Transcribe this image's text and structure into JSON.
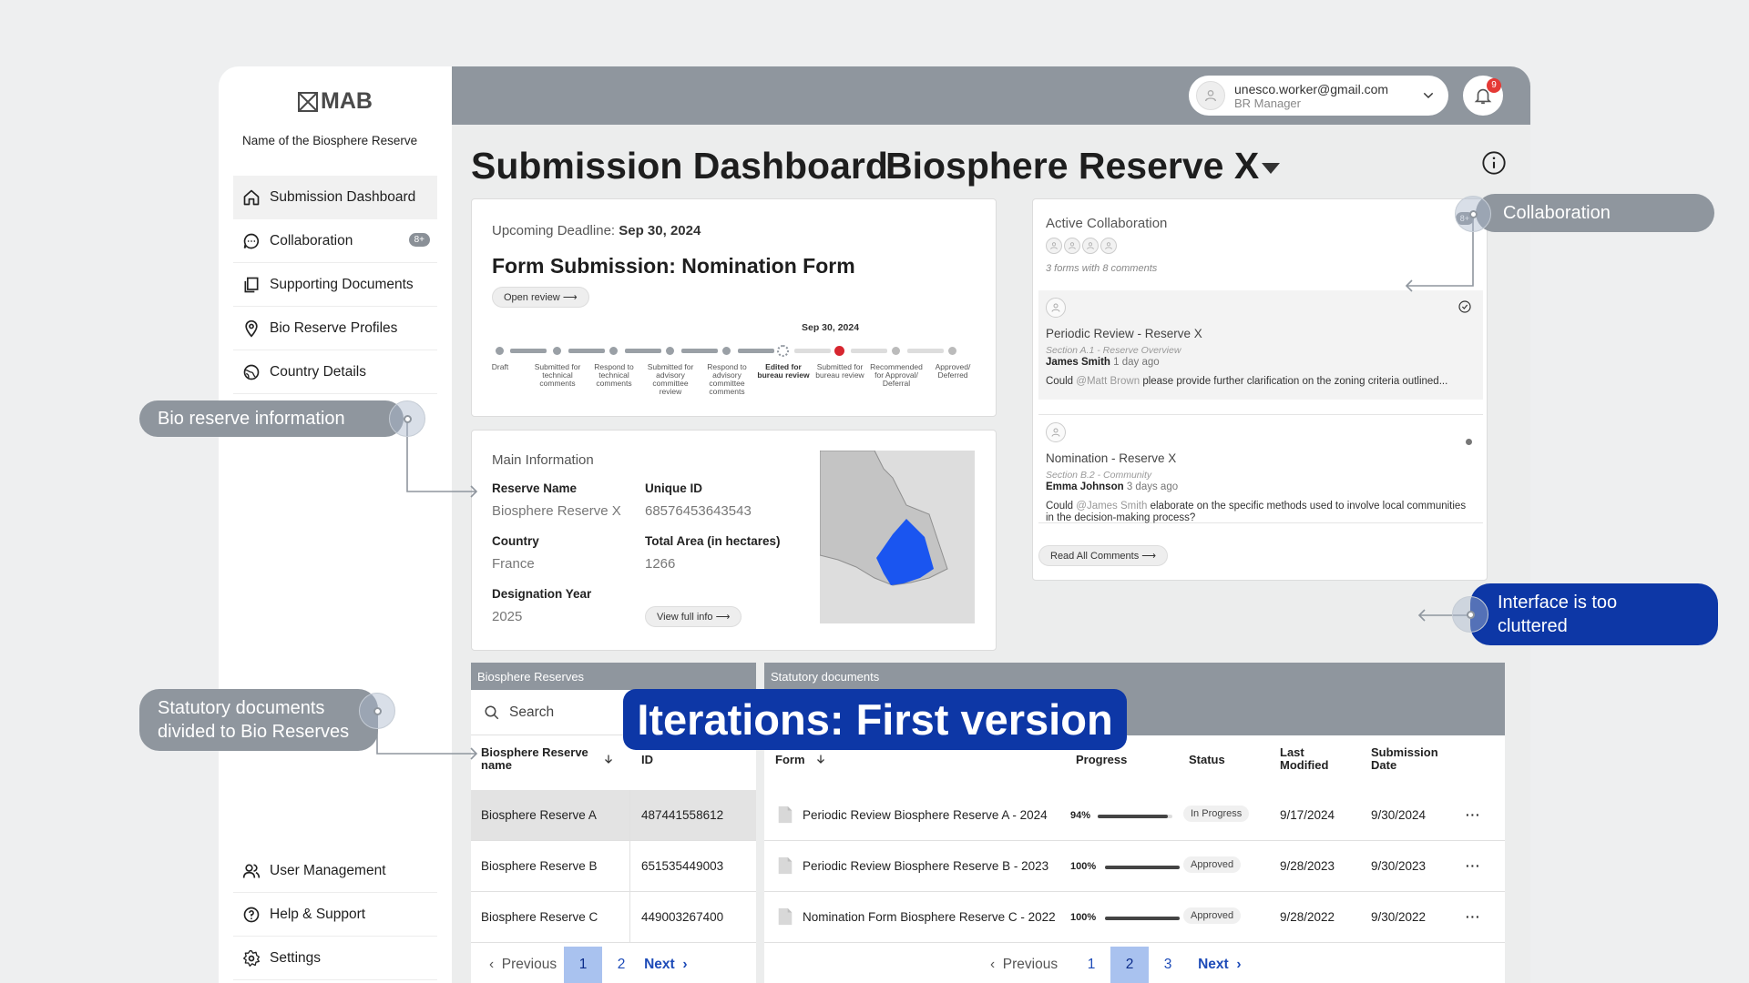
{
  "sidebar": {
    "logo": "MAB",
    "reserve_name": "Name of the Biosphere Reserve",
    "nav": [
      {
        "label": "Submission Dashboard",
        "icon": "home-icon"
      },
      {
        "label": "Collaboration",
        "icon": "chat-icon",
        "badge": "8+"
      },
      {
        "label": "Supporting Documents",
        "icon": "documents-icon"
      },
      {
        "label": "Bio Reserve Profiles",
        "icon": "location-pin-icon"
      },
      {
        "label": "Country Details",
        "icon": "globe-icon"
      }
    ],
    "bottom_nav": [
      {
        "label": "User Management",
        "icon": "users-icon"
      },
      {
        "label": "Help & Support",
        "icon": "help-icon"
      },
      {
        "label": "Settings",
        "icon": "settings-icon"
      }
    ]
  },
  "topbar": {
    "email": "unesco.worker@gmail.com",
    "role": "BR Manager",
    "notification_count": "9"
  },
  "header": {
    "title": "Submission Dashboard",
    "reserve": "Biosphere Reserve X"
  },
  "deadline": {
    "label": "Upcoming Deadline:",
    "date": "Sep 30, 2024",
    "form_title": "Form Submission: Nomination Form",
    "open_review": "Open review",
    "timeline_date": "Sep 30, 2024",
    "steps": [
      {
        "label": "Draft"
      },
      {
        "label": "Submitted for technical comments"
      },
      {
        "label": "Respond to technical comments"
      },
      {
        "label": "Submitted for advisory committee review"
      },
      {
        "label": "Respond to advisory committee comments"
      },
      {
        "label": "Edited for bureau review"
      },
      {
        "label": "Submitted for bureau review"
      },
      {
        "label": "Recommended for Approval/ Deferral"
      },
      {
        "label": "Approved/ Deferred"
      }
    ]
  },
  "main_info": {
    "heading": "Main Information",
    "reserve_name_label": "Reserve Name",
    "reserve_name": "Biosphere Reserve X",
    "unique_id_label": "Unique ID",
    "unique_id": "68576453643543",
    "country_label": "Country",
    "country": "France",
    "area_label": "Total Area (in hectares)",
    "area": "1266",
    "year_label": "Designation Year",
    "year": "2025",
    "view_full": "View full info",
    "map_colors": {
      "land": "#c4c4c4",
      "highlight": "#1a55f0"
    }
  },
  "collaboration": {
    "heading": "Active Collaboration",
    "subtitle": "3 forms with 8 comments",
    "count_badge": "8+",
    "comments": [
      {
        "title": "Periodic Review - Reserve X",
        "section": "Section A.1 - Reserve Overview",
        "author": "James Smith",
        "time": "1 day ago",
        "text_before": "Could",
        "mention": "@Matt Brown",
        "text_after": "please provide further clarification on the zoning criteria outlined..."
      },
      {
        "title": "Nomination - Reserve X",
        "section": "Section B.2 - Community",
        "author": "Emma Johnson",
        "time": "3 days ago",
        "text_before": "Could",
        "mention": "@James Smith",
        "text_after": "elaborate on the specific methods used to involve local communities in the decision-making process?"
      }
    ],
    "read_all": "Read All Comments"
  },
  "biosphere_table": {
    "heading": "Biosphere Reserves",
    "search_placeholder": "Search",
    "col_name": "Biosphere Reserve name",
    "col_id": "ID",
    "rows": [
      {
        "name": "Biosphere Reserve A",
        "id": "487441558612"
      },
      {
        "name": "Biosphere Reserve B",
        "id": "651535449003"
      },
      {
        "name": "Biosphere Reserve C",
        "id": "449003267400"
      }
    ],
    "pager": {
      "prev": "Previous",
      "pages": [
        "1",
        "2"
      ],
      "current": "1",
      "next": "Next"
    }
  },
  "statutory_table": {
    "heading": "Statutory documents",
    "col_form": "Form",
    "col_progress": "Progress",
    "col_status": "Status",
    "col_modified": "Last Modified",
    "col_submission": "Submission Date",
    "rows": [
      {
        "form": "Periodic Review Biosphere Reserve A - 2024",
        "progress_label": "94%",
        "progress": 0.94,
        "status": "In Progress",
        "modified": "9/17/2024",
        "submitted": "9/30/2024"
      },
      {
        "form": "Periodic Review Biosphere Reserve B - 2023",
        "progress_label": "100%",
        "progress": 1.0,
        "status": "Approved",
        "modified": "9/28/2023",
        "submitted": "9/30/2023"
      },
      {
        "form": "Nomination Form Biosphere Reserve C - 2022",
        "progress_label": "100%",
        "progress": 1.0,
        "status": "Approved",
        "modified": "9/28/2022",
        "submitted": "9/30/2022"
      }
    ],
    "pager": {
      "prev": "Previous",
      "pages": [
        "1",
        "2",
        "3"
      ],
      "current": "2",
      "next": "Next"
    }
  },
  "annotations": {
    "bio_reserve": "Bio reserve information",
    "statutory_line1": "Statutory documents",
    "statutory_line2": "divided to Bio Reserves",
    "collaboration": "Collaboration",
    "cluttered_line1": "Interface is too",
    "cluttered_line2": "cluttered",
    "iteration_banner": "Iterations: First version"
  },
  "colors": {
    "accent_blue": "#0d37a6",
    "grey_bar": "#8f969e",
    "alert_red": "#d7262f"
  }
}
